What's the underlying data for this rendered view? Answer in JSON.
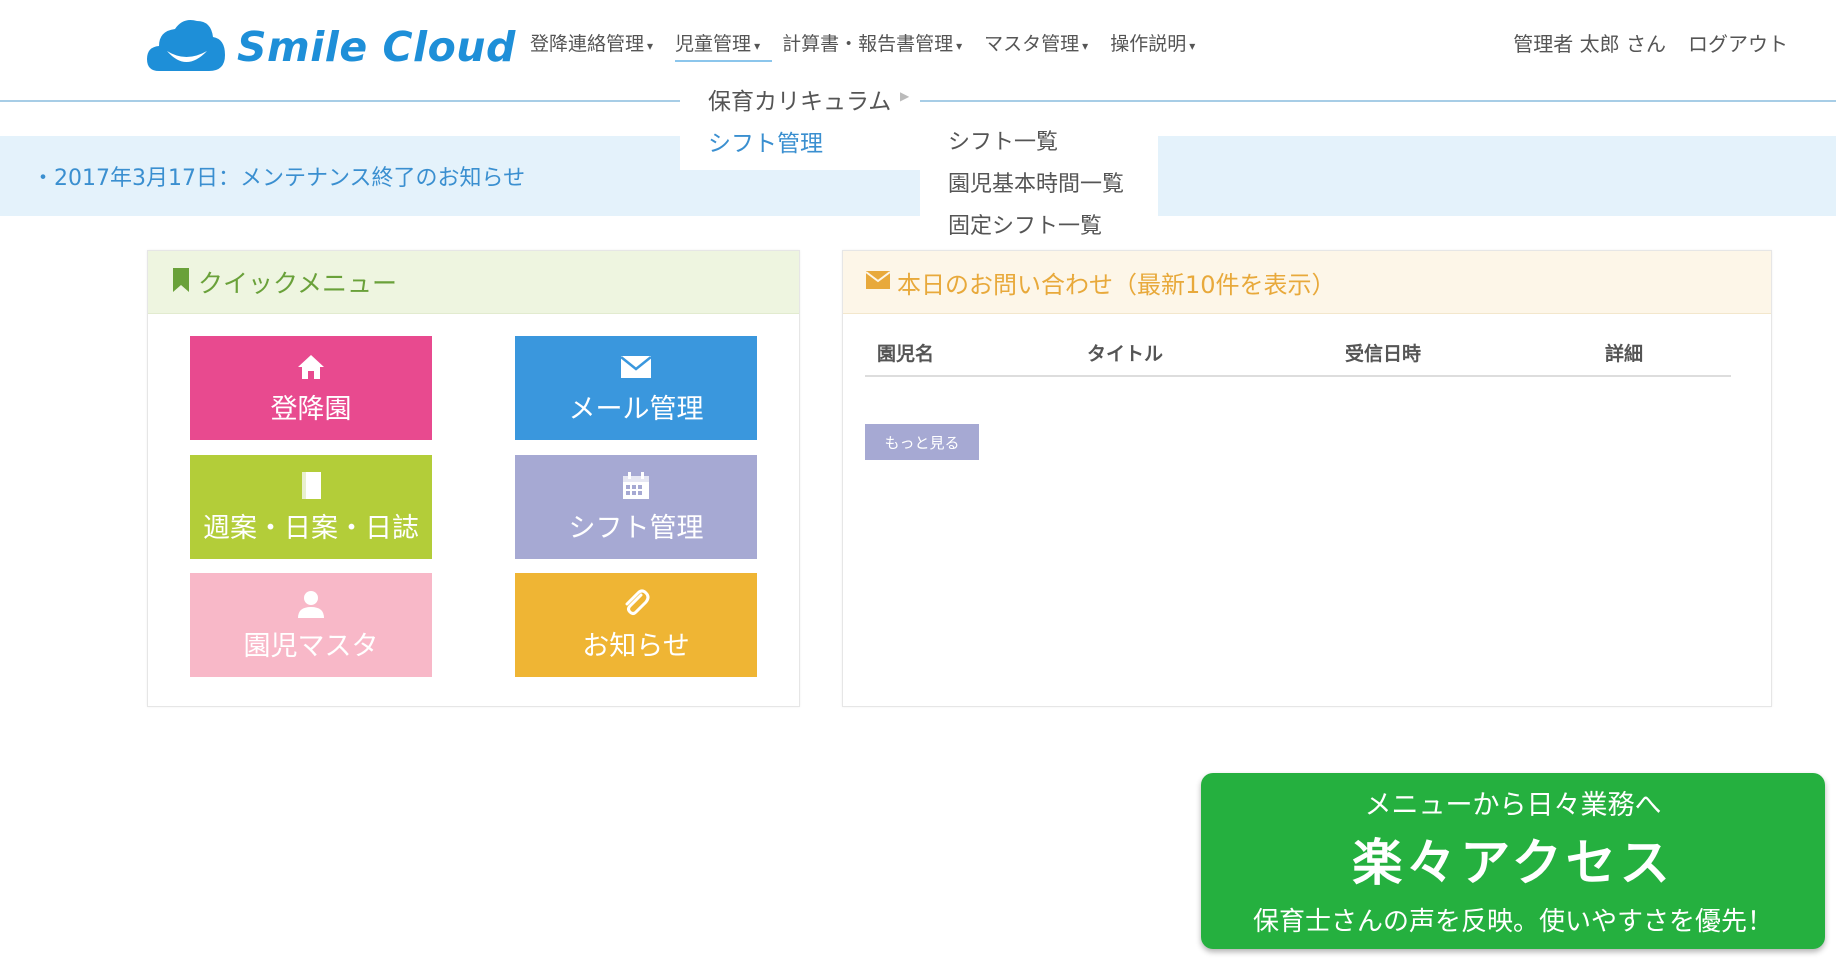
{
  "brand": {
    "name": "Smile Cloud",
    "color": "#1e8fd8"
  },
  "nav": {
    "items": [
      {
        "label": "登降連絡管理"
      },
      {
        "label": "児童管理"
      },
      {
        "label": "計算書・報告書管理"
      },
      {
        "label": "マスタ管理"
      },
      {
        "label": "操作説明"
      }
    ],
    "active": "児童管理"
  },
  "user": {
    "name": "管理者 太郎 さん",
    "logout_label": "ログアウト"
  },
  "dropdown": {
    "items": [
      "保育カリキュラム",
      "シフト管理"
    ],
    "submenu": [
      "シフト一覧",
      "園児基本時間一覧",
      "固定シフト一覧"
    ]
  },
  "notice": {
    "text": "・2017年3月17日：メンテナンス終了のお知らせ"
  },
  "quick_menu": {
    "title": "クイックメニュー",
    "tiles": [
      {
        "label": "登降園",
        "icon": "home-icon",
        "color": "#e84a8f"
      },
      {
        "label": "メール管理",
        "icon": "envelope-icon",
        "color": "#3a97dd"
      },
      {
        "label": "週案・日案・日誌",
        "icon": "book-icon",
        "color": "#b3cd39"
      },
      {
        "label": "シフト管理",
        "icon": "calendar-icon",
        "color": "#a6a9d3"
      },
      {
        "label": "園児マスタ",
        "icon": "user-icon",
        "color": "#f8b8c8"
      },
      {
        "label": "お知らせ",
        "icon": "paperclip-icon",
        "color": "#efb534"
      }
    ]
  },
  "inquiries": {
    "title": "本日のお問い合わせ（最新10件を表示）",
    "columns": [
      "園児名",
      "タイトル",
      "受信日時",
      "詳細"
    ],
    "rows": [],
    "more_label": "もっと見る"
  },
  "callout": {
    "line1": "メニューから日々業務へ",
    "headline": "楽々アクセス",
    "line3": "保育士さんの声を反映。使いやすさを優先！",
    "color": "#25b03f"
  }
}
